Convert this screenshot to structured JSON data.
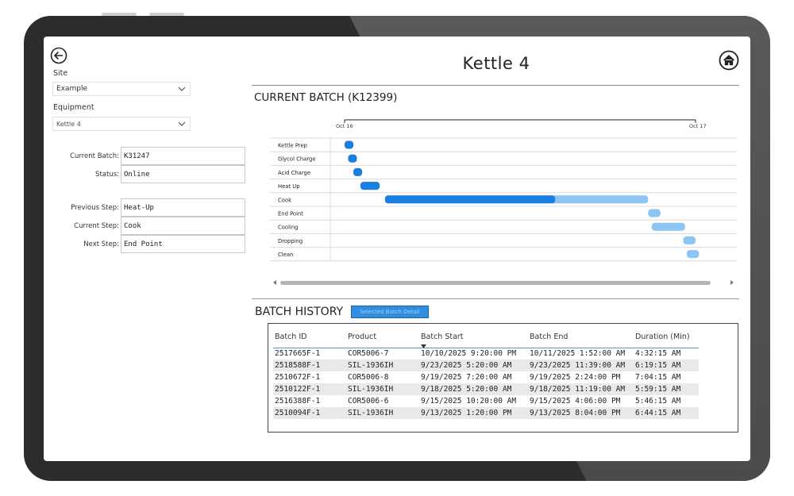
{
  "app": {
    "title": "Kettle 4",
    "accent_color": "#1a7fe0",
    "accent_light_color": "#8cc4f4"
  },
  "filters": {
    "site_label": "Site",
    "site_value": "Example",
    "equipment_label": "Equipment",
    "equipment_value": "Kettle 4"
  },
  "status": {
    "current_batch_label": "Current Batch:",
    "current_batch_value": "K31247",
    "status_label": "Status:",
    "status_value": "Online",
    "previous_step_label": "Previous Step:",
    "previous_step_value": "Heat-Up",
    "current_step_label": "Current Step:",
    "current_step_value": "Cook",
    "next_step_label": "Next Step:",
    "next_step_value": "End Point"
  },
  "current_batch": {
    "title": "CURRENT BATCH (K12399)"
  },
  "chart_data": {
    "type": "gantt",
    "timeline_start_label": "Oct 16",
    "timeline_end_label": "Oct 17",
    "range": [
      0,
      1
    ],
    "tasks": [
      {
        "name": "Kettle Prep",
        "start": 0.0,
        "end": 0.025,
        "done_end": 0.025
      },
      {
        "name": "Glycol Charge",
        "start": 0.01,
        "end": 0.035,
        "done_end": 0.035
      },
      {
        "name": "Acid Charge",
        "start": 0.025,
        "end": 0.05,
        "done_end": 0.05
      },
      {
        "name": "Heat Up",
        "start": 0.045,
        "end": 0.1,
        "done_end": 0.1
      },
      {
        "name": "Cook",
        "start": 0.115,
        "end": 0.865,
        "done_end": 0.6
      },
      {
        "name": "End Point",
        "start": 0.865,
        "end": 0.9,
        "done_end": 0.865
      },
      {
        "name": "Cooling",
        "start": 0.875,
        "end": 0.97,
        "done_end": 0.875
      },
      {
        "name": "Dropping",
        "start": 0.965,
        "end": 1.0,
        "done_end": 0.965
      },
      {
        "name": "Clean",
        "start": 0.975,
        "end": 1.01,
        "done_end": 0.975
      }
    ]
  },
  "history": {
    "title": "BATCH HISTORY",
    "detail_button": "Selected Batch Detail",
    "columns": [
      "Batch ID",
      "Product",
      "Batch Start",
      "Batch End",
      "Duration (Min)"
    ],
    "rows": [
      [
        "2517665F-1",
        "COR5006-7",
        "10/10/2025 9:20:00 PM",
        "10/11/2025 1:52:00 AM",
        "4:32:15 AM"
      ],
      [
        "2518588F-1",
        "SIL-1936IH",
        "9/23/2025 5:20:00 AM",
        "9/23/2025 11:39:00 AM",
        "6:19:15 AM"
      ],
      [
        "2510672F-1",
        "COR5006-8",
        "9/19/2025 7:20:00 AM",
        "9/19/2025 2:24:00 PM",
        "7:04:15 AM"
      ],
      [
        "2510122F-1",
        "SIL-1936IH",
        "9/18/2025 5:20:00 AM",
        "9/18/2025 11:19:00 AM",
        "5:59:15 AM"
      ],
      [
        "2516388F-1",
        "COR5006-6",
        "9/15/2025 10:20:00 AM",
        "9/15/2025 4:06:00 PM",
        "5:46:15 AM"
      ],
      [
        "2510094F-1",
        "SIL-1936IH",
        "9/13/2025 1:20:00 PM",
        "9/13/2025 8:04:00 PM",
        "6:44:15 AM"
      ]
    ]
  }
}
